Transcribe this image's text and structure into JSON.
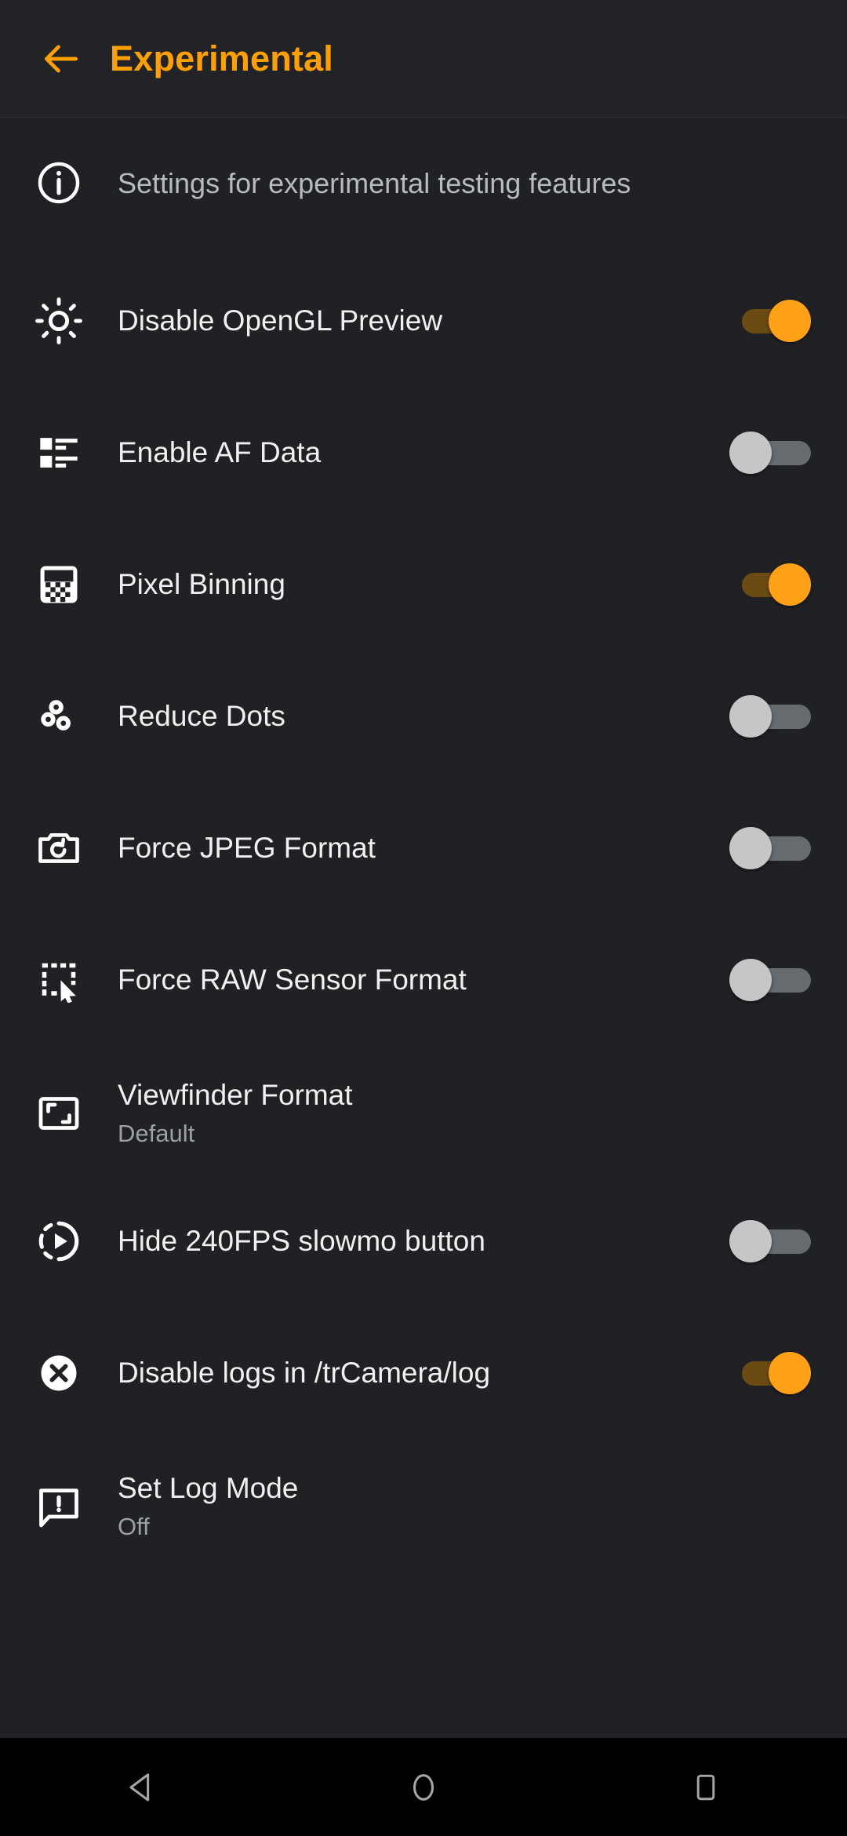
{
  "header": {
    "back_icon": "arrow-back-icon",
    "title": "Experimental",
    "accent_color": "#FFA000"
  },
  "info": {
    "icon": "info-circle-icon",
    "text": "Settings for experimental testing features"
  },
  "colors": {
    "background": "#1f2124",
    "appbar_background": "#212326",
    "accent": "#FFA000",
    "switch_on_track": "#6b4a14",
    "switch_on_thumb": "#FFA117",
    "switch_off_track": "#666b6f",
    "switch_off_thumb": "#c6c6c6",
    "title_text": "#f0f0f0",
    "subtitle_text": "#9aa0a6",
    "navbar_background": "#000000",
    "navbar_icon": "#a0a0a0"
  },
  "settings": [
    {
      "icon": "brightness-sun-icon",
      "title": "Disable OpenGL Preview",
      "subtitle": "",
      "control": "switch",
      "value": "on"
    },
    {
      "icon": "view-list-icon",
      "title": "Enable AF Data",
      "subtitle": "",
      "control": "switch",
      "value": "off"
    },
    {
      "icon": "checkerboard-grid-icon",
      "title": "Pixel Binning",
      "subtitle": "",
      "control": "switch",
      "value": "on"
    },
    {
      "icon": "three-dots-icon",
      "title": "Reduce Dots",
      "subtitle": "",
      "control": "switch",
      "value": "off"
    },
    {
      "icon": "camera-refresh-icon",
      "title": "Force JPEG Format",
      "subtitle": "",
      "control": "switch",
      "value": "off"
    },
    {
      "icon": "selection-cursor-icon",
      "title": "Force RAW Sensor Format",
      "subtitle": "",
      "control": "switch",
      "value": "off"
    },
    {
      "icon": "fit-screen-icon",
      "title": "Viewfinder Format",
      "subtitle": "Default",
      "control": "none",
      "value": ""
    },
    {
      "icon": "slow-motion-icon",
      "title": "Hide 240FPS slowmo button",
      "subtitle": "",
      "control": "switch",
      "value": "off"
    },
    {
      "icon": "cancel-circle-icon",
      "title": "Disable logs in /trCamera/log",
      "subtitle": "",
      "control": "switch",
      "value": "on"
    },
    {
      "icon": "feedback-bubble-icon",
      "title": "Set Log Mode",
      "subtitle": "Off",
      "control": "none",
      "value": ""
    }
  ],
  "navbar": {
    "buttons": [
      {
        "icon": "nav-back-triangle-icon",
        "label": "Back"
      },
      {
        "icon": "nav-home-circle-icon",
        "label": "Home"
      },
      {
        "icon": "nav-recents-square-icon",
        "label": "Recents"
      }
    ]
  }
}
